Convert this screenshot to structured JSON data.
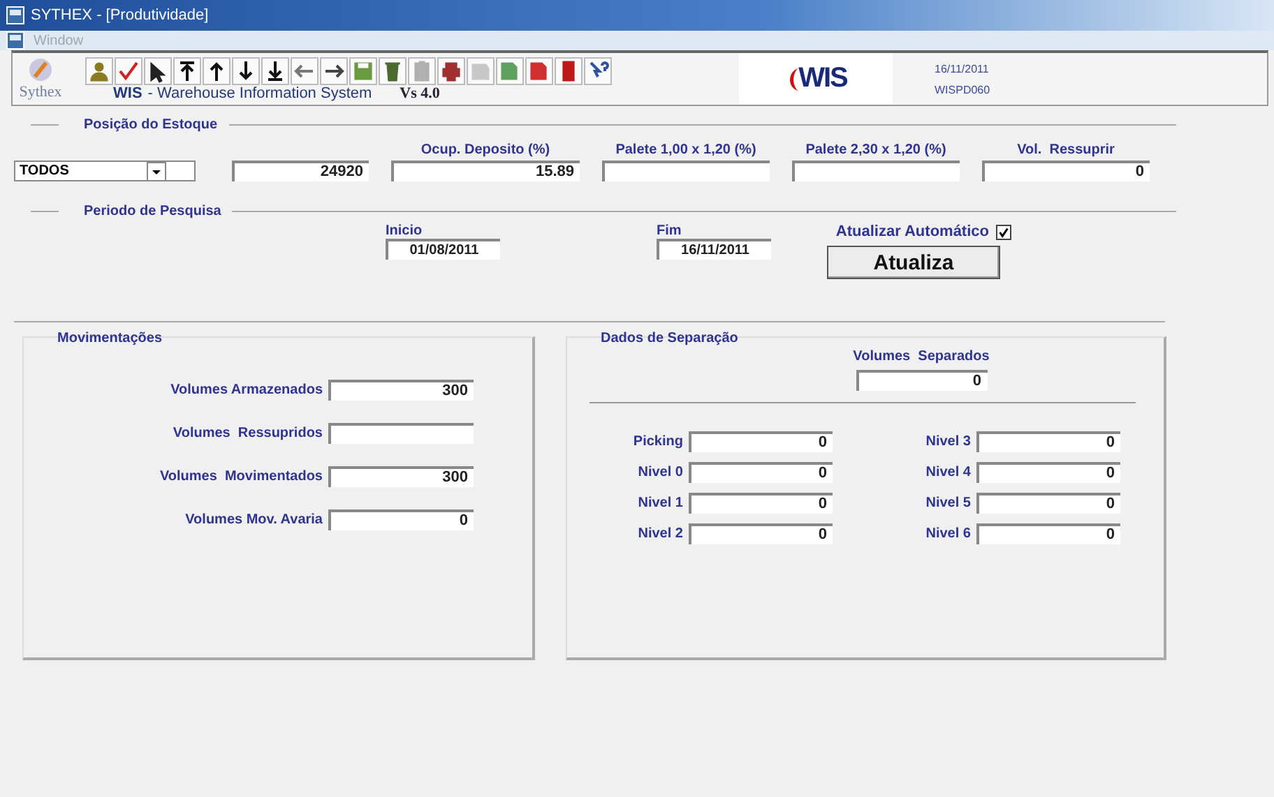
{
  "window": {
    "title": "SYTHEX - [Produtividade]"
  },
  "menu": [
    "Window"
  ],
  "header": {
    "logo": "Sythex",
    "app_name": "WIS",
    "app_subtitle": "- Warehouse Information System",
    "version": "Vs 4.0",
    "brand": "WIS",
    "date": "16/11/2011",
    "screen_code": "WISPD060"
  },
  "stock_position": {
    "title": "Posição do Estoque",
    "filter": "TODOS",
    "count": "24920",
    "fields": [
      {
        "label": "Ocup. Deposito (%)",
        "value": "15.89"
      },
      {
        "label": "Palete 1,00 x 1,20 (%)"
      },
      {
        "label": "Palete 2,30 x 1,20 (%)"
      },
      {
        "label": "Vol.  Ressuprir",
        "value": "0"
      }
    ]
  },
  "search_period": {
    "title": "Periodo de Pesquisa",
    "start_label": "Inicio",
    "start": "01/08/2011",
    "end_label": "Fim",
    "end": "16/11/2011",
    "auto_update": {
      "label": "Atualizar Automático",
      "checked": true
    },
    "button": "Atualiza"
  },
  "movements": {
    "title": "Movimentações",
    "rows": [
      {
        "label": "Volumes Armazenados",
        "value": "300"
      },
      {
        "label": "Volumes  Ressupridos"
      },
      {
        "label": "Volumes  Movimentados",
        "value": "300"
      },
      {
        "label": "Volumes Mov. Avaria",
        "value": "0"
      }
    ]
  },
  "separation": {
    "title": "Dados de Separação",
    "total_label": "Volumes  Separados",
    "total": "0",
    "levels": [
      {
        "label": "Picking",
        "value": "0"
      },
      {
        "label": "Nivel 0",
        "value": "0"
      },
      {
        "label": "Nivel 1",
        "value": "0"
      },
      {
        "label": "Nivel 2",
        "value": "0"
      },
      {
        "label": "Nivel 3",
        "value": "0"
      },
      {
        "label": "Nivel 4",
        "value": "0"
      },
      {
        "label": "Nivel 5",
        "value": "0"
      },
      {
        "label": "Nivel 6",
        "value": "0"
      }
    ]
  }
}
